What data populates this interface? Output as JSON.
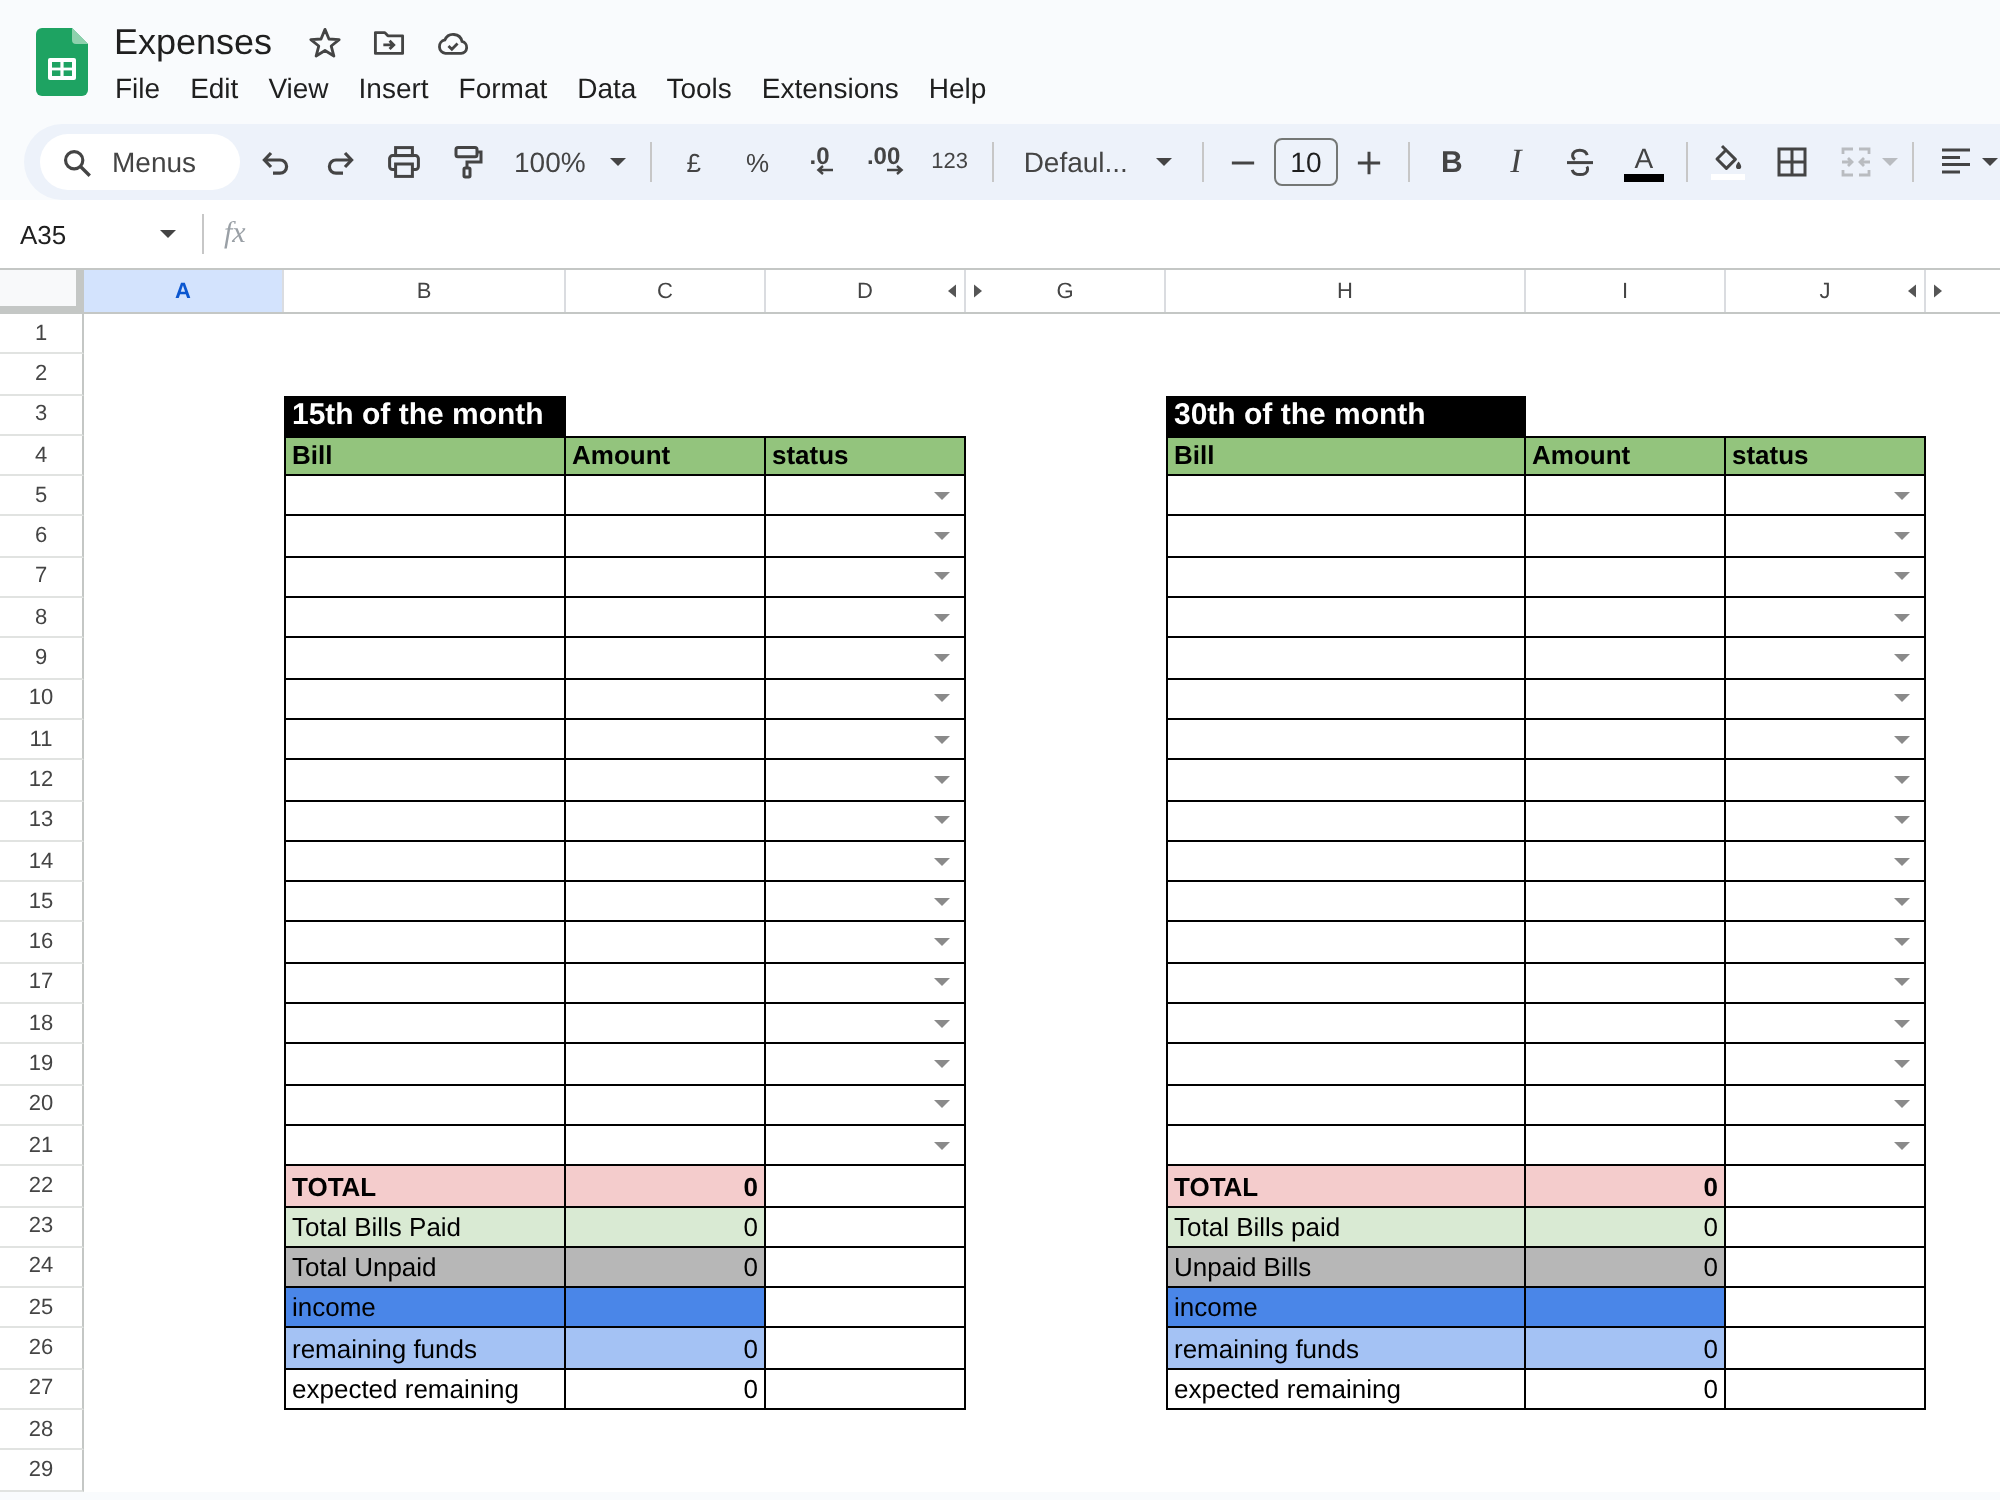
{
  "app": {
    "title": "Expenses"
  },
  "menu": [
    "File",
    "Edit",
    "View",
    "Insert",
    "Format",
    "Data",
    "Tools",
    "Extensions",
    "Help"
  ],
  "toolbar": {
    "search": {
      "placeholder": "Menus"
    },
    "zoom": "100%",
    "currency": "£",
    "percent": "%",
    "decrease_decimal": ".0",
    "increase_decimal": ".00",
    "number_format": "123",
    "font": "Defaul...",
    "font_size": "10",
    "bold_label": "B",
    "italic_label": "I",
    "text_color_label": "A",
    "merge_cells": {
      "disabled": true
    }
  },
  "formula_bar": {
    "cell_reference": "A35",
    "function_label": "fx"
  },
  "sheet": {
    "columns": [
      {
        "label": "A",
        "selected": true,
        "hidden_after": false
      },
      {
        "label": "B",
        "selected": false,
        "hidden_after": false
      },
      {
        "label": "C",
        "selected": false,
        "hidden_after": false
      },
      {
        "label": "D",
        "selected": false,
        "hidden_after": true
      },
      {
        "label": "G",
        "selected": false,
        "hidden_after": false
      },
      {
        "label": "H",
        "selected": false,
        "hidden_after": false
      },
      {
        "label": "I",
        "selected": false,
        "hidden_after": false
      },
      {
        "label": "J",
        "selected": false,
        "hidden_after": true
      }
    ],
    "row_numbers": [
      "1",
      "2",
      "3",
      "4",
      "5",
      "6",
      "7",
      "8",
      "9",
      "10",
      "11",
      "12",
      "13",
      "14",
      "15",
      "16",
      "17",
      "18",
      "19",
      "20",
      "21",
      "22",
      "23",
      "24",
      "25",
      "26",
      "27",
      "28",
      "29"
    ]
  },
  "tables": [
    {
      "title": "15th of the month",
      "columns": [
        "Bill",
        "Amount",
        "status"
      ],
      "entry_rows": [
        {
          "status_dropdown": true
        },
        {
          "status_dropdown": true
        },
        {
          "status_dropdown": true
        },
        {
          "status_dropdown": true
        },
        {
          "status_dropdown": true
        },
        {
          "status_dropdown": true
        },
        {
          "status_dropdown": true
        },
        {
          "status_dropdown": true
        },
        {
          "status_dropdown": true
        },
        {
          "status_dropdown": true
        },
        {
          "status_dropdown": true
        },
        {
          "status_dropdown": true
        },
        {
          "status_dropdown": true
        },
        {
          "status_dropdown": true
        },
        {
          "status_dropdown": true
        },
        {
          "status_dropdown": true
        },
        {
          "status_dropdown": true
        }
      ],
      "summary_rows": [
        {
          "label": "TOTAL",
          "value": "0",
          "bold": true,
          "color": "#f4cccc"
        },
        {
          "label": "Total Bills Paid",
          "value": "0",
          "bold": false,
          "color": "#d9ead3"
        },
        {
          "label": "Total Unpaid",
          "value": "0",
          "bold": false,
          "color": "#b7b7b7"
        },
        {
          "label": "income",
          "bold": false,
          "color": "#4a86e8"
        },
        {
          "label": "remaining funds",
          "value": "0",
          "bold": false,
          "color": "#a4c2f4"
        },
        {
          "label": "expected remaining",
          "value": "0",
          "bold": false,
          "color": "#ffffff"
        }
      ]
    },
    {
      "title": "30th of the month",
      "columns": [
        "Bill",
        "Amount",
        "status"
      ],
      "entry_rows": [
        {
          "status_dropdown": true
        },
        {
          "status_dropdown": true
        },
        {
          "status_dropdown": true
        },
        {
          "status_dropdown": true
        },
        {
          "status_dropdown": true
        },
        {
          "status_dropdown": true
        },
        {
          "status_dropdown": true
        },
        {
          "status_dropdown": true
        },
        {
          "status_dropdown": true
        },
        {
          "status_dropdown": true
        },
        {
          "status_dropdown": true
        },
        {
          "status_dropdown": true
        },
        {
          "status_dropdown": true
        },
        {
          "status_dropdown": true
        },
        {
          "status_dropdown": true
        },
        {
          "status_dropdown": true
        },
        {
          "status_dropdown": true
        }
      ],
      "summary_rows": [
        {
          "label": "TOTAL",
          "value": "0",
          "bold": true,
          "color": "#f4cccc"
        },
        {
          "label": "Total Bills paid",
          "value": "0",
          "bold": false,
          "color": "#d9ead3"
        },
        {
          "label": "Unpaid Bills",
          "value": "0",
          "bold": false,
          "color": "#b7b7b7"
        },
        {
          "label": "income",
          "bold": false,
          "color": "#4a86e8"
        },
        {
          "label": "remaining funds",
          "value": "0",
          "bold": false,
          "color": "#a4c2f4"
        },
        {
          "label": "expected remaining",
          "value": "0",
          "bold": false,
          "color": "#ffffff"
        }
      ]
    }
  ]
}
